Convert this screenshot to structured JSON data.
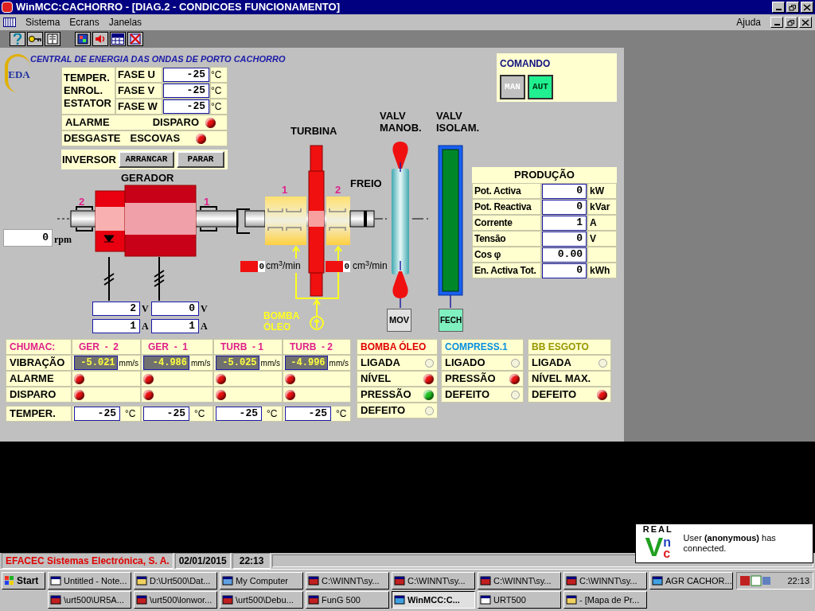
{
  "window": {
    "title": "WinMCC:CACHORRO - [DIAG.2 - CONDICOES FUNCIONAMENTO]"
  },
  "menu": [
    {
      "label": "Sistema"
    },
    {
      "label": "Ecrans"
    },
    {
      "label": "Janelas"
    }
  ],
  "help_menu": "Ajuda",
  "plant": {
    "logo": "EDA",
    "title": "CENTRAL DE ENERGIA DAS ONDAS DE PORTO CACHORRO"
  },
  "stator": {
    "label_lines": [
      "TEMPER.",
      "ENROL.",
      "ESTATOR"
    ],
    "phases": [
      {
        "label": "FASE U",
        "value": "-25",
        "unit": "°C"
      },
      {
        "label": "FASE V",
        "value": "-25",
        "unit": "°C"
      },
      {
        "label": "FASE W",
        "value": "-25",
        "unit": "°C"
      }
    ],
    "alarm": {
      "label": "ALARME",
      "trip_label": "DISPARO",
      "on": true
    },
    "wear": {
      "label": "DESGASTE",
      "label2": "ESCOVAS",
      "on": true
    }
  },
  "inverter": {
    "label": "INVERSOR",
    "buttons": [
      "ARRANCAR",
      "PARAR"
    ]
  },
  "command": {
    "title": "COMANDO",
    "buttons": [
      {
        "label": "MAN",
        "selected": false
      },
      {
        "label": "AUT",
        "selected": true
      }
    ]
  },
  "diagram": {
    "generator_label": "GERADOR",
    "turbine_label": "TURBINA",
    "brake_label": "FREIO",
    "valve1_label": [
      "VALV",
      "MANOB."
    ],
    "valve2_label": [
      "VALV",
      "ISOLAM."
    ],
    "bearing_numbers": [
      "2",
      "1",
      "1",
      "2"
    ],
    "rpm": {
      "value": "0",
      "unit": "rpm"
    },
    "flows": [
      {
        "value": "0",
        "unit": "cm$^{3}$/min"
      },
      {
        "value": "0",
        "unit": "cm$^{3}$/min"
      }
    ],
    "electrical": [
      {
        "value": "2",
        "unit": "V"
      },
      {
        "value": "0",
        "unit": "V"
      },
      {
        "value": "1",
        "unit": "A"
      },
      {
        "value": "1",
        "unit": "A"
      }
    ],
    "pump_label": [
      "BOMBA",
      "ÓLEO"
    ],
    "valve1_state": "MOV",
    "valve2_state": "FECH"
  },
  "production": {
    "title": "PRODUÇÃO",
    "rows": [
      {
        "label": "Pot. Activa",
        "value": "0",
        "unit": "kW"
      },
      {
        "label": "Pot. Reactiva",
        "value": "0",
        "unit": "kVar"
      },
      {
        "label": "Corrente",
        "value": "1",
        "unit": "A"
      },
      {
        "label": "Tensão",
        "value": "0",
        "unit": "V"
      },
      {
        "label": "Cos φ",
        "value": "0.00"
      },
      {
        "label": "En. Activa Tot.",
        "value": "0",
        "unit": "kWh"
      }
    ]
  },
  "bearings": {
    "header": "CHUMAC:",
    "row_labels": [
      "VIBRAÇÃO",
      "ALARME",
      "DISPARO",
      "TEMPER."
    ],
    "columns": [
      {
        "name": "GER  -  2",
        "vibration": "-5.021",
        "vibration_unit": "mm/s",
        "alarm_on": true,
        "trip_on": true,
        "temp": "-25",
        "temp_unit": "°C"
      },
      {
        "name": "GER  -  1",
        "vibration": "-4.986",
        "vibration_unit": "mm/s",
        "alarm_on": true,
        "trip_on": true,
        "temp": "-25",
        "temp_unit": "°C"
      },
      {
        "name": "TURB  - 1",
        "vibration": "-5.025",
        "vibration_unit": "mm/s",
        "alarm_on": true,
        "trip_on": true,
        "temp": "-25",
        "temp_unit": "°C"
      },
      {
        "name": "TURB  - 2",
        "vibration": "-4.996",
        "vibration_unit": "mm/s",
        "alarm_on": true,
        "trip_on": true,
        "temp": "-25",
        "temp_unit": "°C"
      }
    ]
  },
  "systems": [
    {
      "title": "BOMBA ÓLEO",
      "color": "#e00000",
      "items": [
        {
          "label": "LIGADA",
          "kind": "lamp",
          "on": false
        },
        {
          "label": "NÍVEL",
          "kind": "lamp",
          "on": true,
          "color": "#e81010"
        },
        {
          "label": "PRESSÃO",
          "kind": "lamp",
          "on": true,
          "color": "#20c020"
        },
        {
          "label": "DEFEITO",
          "kind": "lamp",
          "on": false
        }
      ]
    },
    {
      "title": "COMPRESS.1",
      "color": "#0890e0",
      "items": [
        {
          "label": "LIGADO",
          "kind": "lamp",
          "on": false
        },
        {
          "label": "PRESSÃO",
          "kind": "lamp",
          "on": true,
          "color": "#e81010"
        },
        {
          "label": "DEFEITO",
          "kind": "lamp",
          "on": false
        }
      ]
    },
    {
      "title": "BB ESGOTO",
      "color": "#989800",
      "items": [
        {
          "label": "LIGADA",
          "kind": "lamp",
          "on": false
        },
        {
          "label": "NÍVEL MAX.",
          "kind": "text"
        },
        {
          "label": "DEFEITO",
          "kind": "lamp",
          "on": true,
          "color": "#e81010"
        }
      ]
    }
  ],
  "status_bar": {
    "company": "EFACEC Sistemas Electrónica, S. A.",
    "date": "02/01/2015",
    "time": "22:13"
  },
  "notification": {
    "brand": "REAL",
    "logo_letters": [
      "V",
      "n",
      "c"
    ],
    "message": "User **(anonymous)** has connected."
  },
  "taskbar": {
    "start": "Start",
    "clock": "22:13",
    "rows": [
      [
        {
          "label": "Untitled - Note...",
          "selected": false
        },
        {
          "label": "D:\\Urt500\\Dat...",
          "selected": false
        },
        {
          "label": "My Computer",
          "selected": false
        },
        {
          "label": "C:\\WINNT\\sy...",
          "selected": false
        },
        {
          "label": "C:\\WINNT\\sy...",
          "selected": false
        },
        {
          "label": "C:\\WINNT\\sy...",
          "selected": false
        },
        {
          "label": "C:\\WINNT\\sy...",
          "selected": false
        },
        {
          "label": "AGR CACHOR...",
          "selected": false
        }
      ],
      [
        {
          "label": "\\urt500\\UR5A...",
          "selected": false
        },
        {
          "label": "\\urt500\\lonwor...",
          "selected": false
        },
        {
          "label": "\\urt500\\Debu...",
          "selected": false
        },
        {
          "label": "FunG 500",
          "selected": false
        },
        {
          "label": "WinMCC:C...",
          "selected": true
        },
        {
          "label": "URT500",
          "selected": false
        },
        {
          "label": "- [Mapa de Pr...",
          "selected": false
        }
      ]
    ]
  }
}
